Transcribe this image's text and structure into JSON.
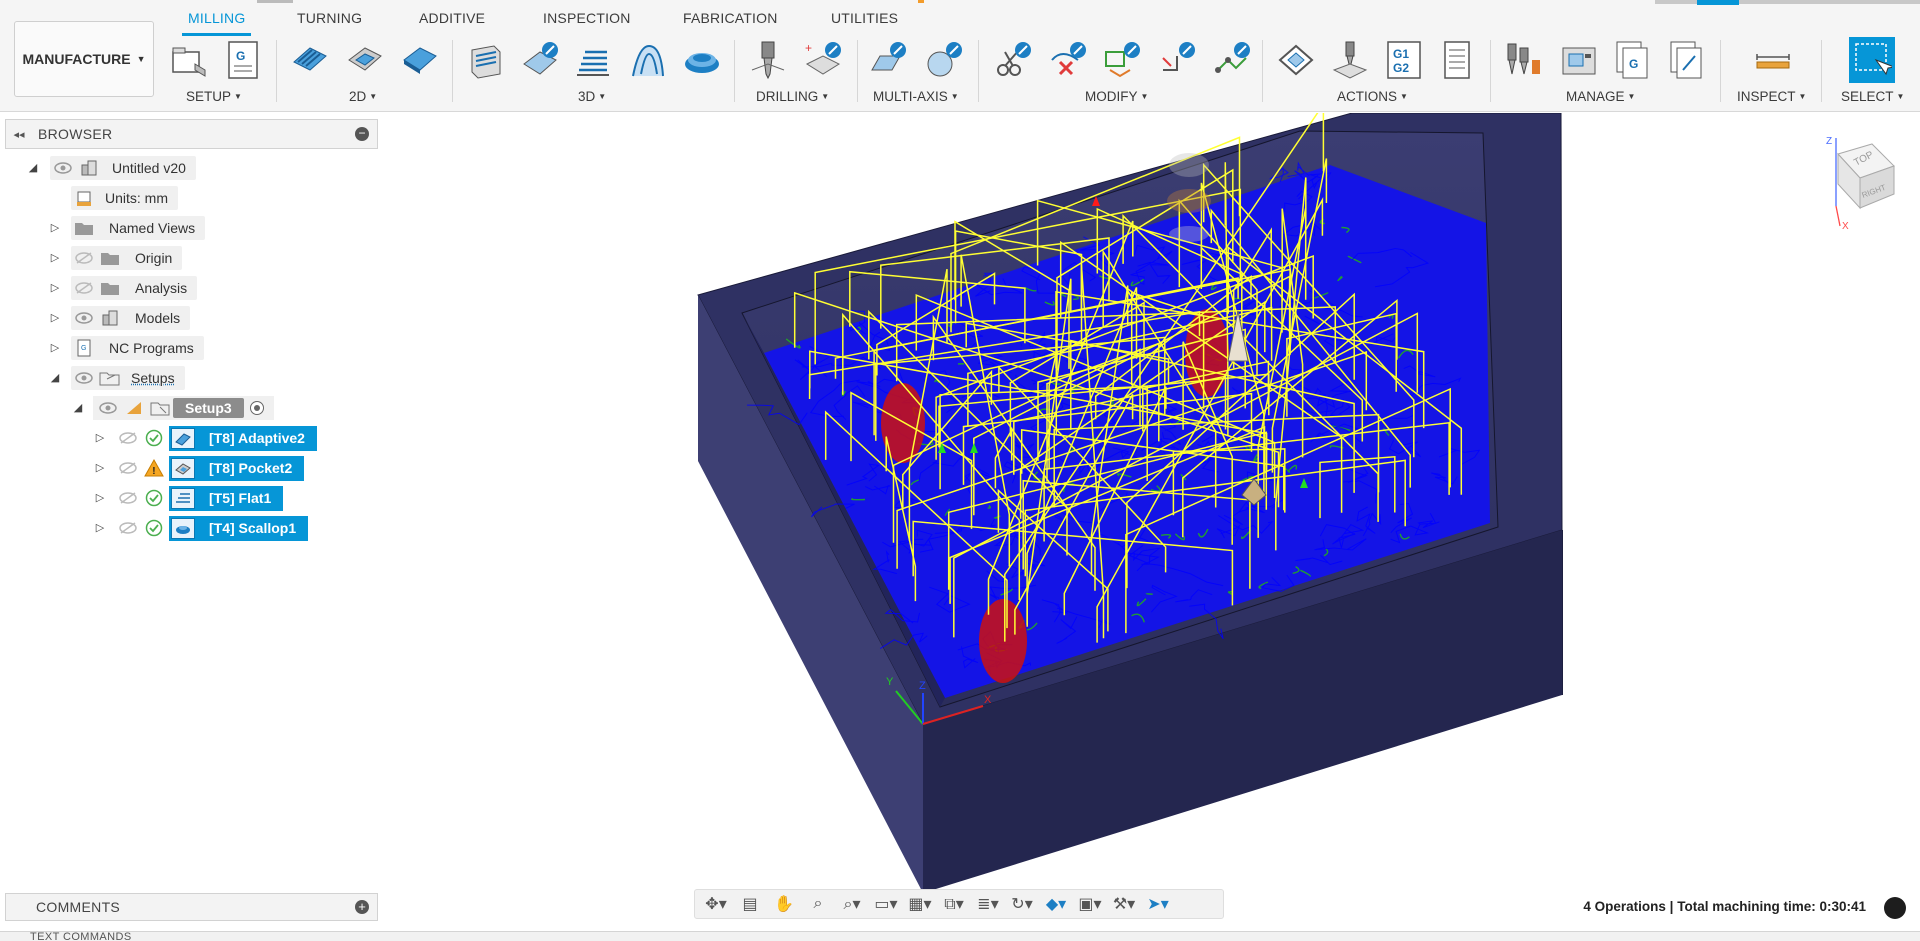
{
  "tabs": [
    "MILLING",
    "TURNING",
    "ADDITIVE",
    "INSPECTION",
    "FABRICATION",
    "UTILITIES"
  ],
  "active_tab": "MILLING",
  "workspace": "MANUFACTURE",
  "groups": {
    "setup": "SETUP",
    "g2d": "2D",
    "g3d": "3D",
    "drilling": "DRILLING",
    "multiaxis": "MULTI-AXIS",
    "modify": "MODIFY",
    "actions": "ACTIONS",
    "manage": "MANAGE",
    "inspect": "INSPECT",
    "select": "SELECT"
  },
  "browser": {
    "title": "BROWSER",
    "root": "Untitled v20",
    "units": "Units: mm",
    "nodes": [
      "Named Views",
      "Origin",
      "Analysis",
      "Models",
      "NC Programs",
      "Setups"
    ],
    "setup": "Setup3",
    "operations": [
      {
        "label": "[T8] Adaptive2",
        "status": "ok"
      },
      {
        "label": "[T8] Pocket2",
        "status": "warning"
      },
      {
        "label": "[T5] Flat1",
        "status": "ok"
      },
      {
        "label": "[T4] Scallop1",
        "status": "ok"
      }
    ]
  },
  "comments": "COMMENTS",
  "text_commands": "TEXT COMMANDS",
  "status": "4 Operations | Total machining time: 0:30:41",
  "viewcube": {
    "top": "TOP",
    "right": "RIGHT"
  },
  "axes": {
    "x": "X",
    "y": "Y",
    "z": "Z"
  },
  "colors": {
    "accent": "#0696d7",
    "stock": "#2b2d5c",
    "toolpath_cut": "#1010ff",
    "toolpath_rapid": "#ffff33",
    "toolpath_lead": "#22aa22",
    "plunge": "#cc1111"
  }
}
